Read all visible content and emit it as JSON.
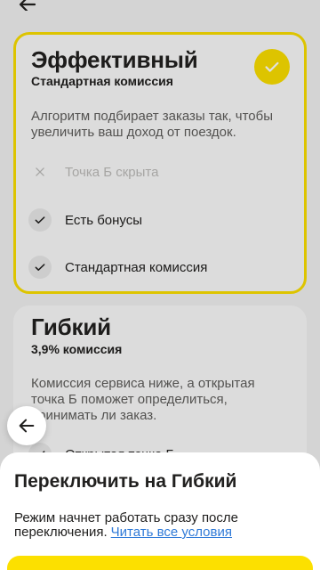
{
  "header": {
    "back_icon": "arrow-left-icon"
  },
  "modes": [
    {
      "title": "Эффективный",
      "subtitle": "Стандартная комиссия",
      "selected": true,
      "selected_icon": "check-icon",
      "description_lines": [
        "Алгоритм подбирает заказы так, чтобы",
        "увеличить ваш доход от поездок."
      ],
      "features": [
        {
          "label": "Точка Б скрыта",
          "icon": "close-icon",
          "available": false
        },
        {
          "label": "Есть бонусы",
          "icon": "check-icon",
          "available": true
        },
        {
          "label": "Стандартная комиссия",
          "icon": "check-icon",
          "available": true
        }
      ]
    },
    {
      "title": "Гибкий",
      "subtitle": "3,9% комиссия",
      "selected": false,
      "description_lines": [
        "Комиссия сервиса ниже, а открытая",
        "точка Б поможет определиться,",
        "принимать ли заказ."
      ],
      "features": [
        {
          "label": "Открытая точка Б",
          "icon": "check-icon",
          "available": true
        }
      ]
    }
  ],
  "floating_back": {
    "icon": "arrow-left-icon"
  },
  "sheet": {
    "title": "Переключить на Гибкий",
    "text_lines": [
      "Режим начнет работать сразу после",
      "переключения."
    ],
    "link": "Читать все условия"
  },
  "colors": {
    "accent": "#fce000",
    "link": "#2f7ad8",
    "text": "#21201f"
  }
}
